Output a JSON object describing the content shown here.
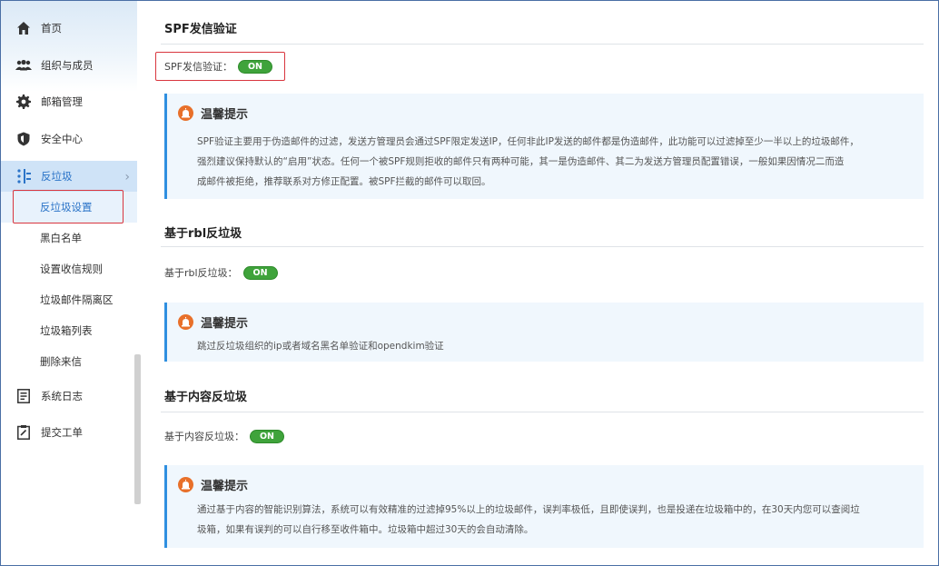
{
  "sidebar": {
    "items": [
      {
        "label": "首页",
        "icon": "home-icon"
      },
      {
        "label": "组织与成员",
        "icon": "users-icon"
      },
      {
        "label": "邮箱管理",
        "icon": "gear-icon"
      },
      {
        "label": "安全中心",
        "icon": "shield-icon"
      },
      {
        "label": "反垃圾",
        "icon": "antispam-icon"
      }
    ],
    "sub_items": [
      "反垃圾设置",
      "黑白名单",
      "设置收信规则",
      "垃圾邮件隔离区",
      "垃圾箱列表",
      "删除来信"
    ],
    "bottom_items": [
      {
        "label": "系统日志",
        "icon": "log-icon"
      },
      {
        "label": "提交工单",
        "icon": "ticket-icon"
      }
    ]
  },
  "sections": [
    {
      "title": "SPF发信验证",
      "row_label": "SPF发信验证：",
      "toggle": "ON",
      "tip_title": "温馨提示",
      "tip_lines": [
        "SPF验证主要用于伪造邮件的过滤，发送方管理员会通过SPF限定发送IP，任何非此IP发送的邮件都是伪造邮件，此功能可以过滤掉至少一半以上的垃圾邮件，",
        "强烈建议保持默认的“启用”状态。任何一个被SPF规则拒收的邮件只有两种可能，其一是伪造邮件、其二为发送方管理员配置错误，一般如果因情况二而造",
        "成邮件被拒绝，推荐联系对方修正配置。被SPF拦截的邮件可以取回。"
      ]
    },
    {
      "title": "基于rbl反垃圾",
      "row_label": "基于rbl反垃圾：",
      "toggle": "ON",
      "tip_title": "温馨提示",
      "tip_lines": [
        "跳过反垃圾组织的ip或者域名黑名单验证和opendkim验证"
      ]
    },
    {
      "title": "基于内容反垃圾",
      "row_label": "基于内容反垃圾：",
      "toggle": "ON",
      "tip_title": "温馨提示",
      "tip_lines": [
        "通过基于内容的智能识别算法，系统可以有效精准的过滤掉95%以上的垃圾邮件，误判率极低，且即使误判，也是投递在垃圾箱中的，在30天内您可以查阅垃",
        "圾箱，如果有误判的可以自行移至收件箱中。垃圾箱中超过30天的会自动清除。"
      ]
    }
  ],
  "colors": {
    "accent": "#2b74c8",
    "toggle_on": "#3fa33b",
    "highlight": "#d9363e",
    "tip_bg": "#f0f7fd",
    "tip_icon": "#e8702a"
  }
}
